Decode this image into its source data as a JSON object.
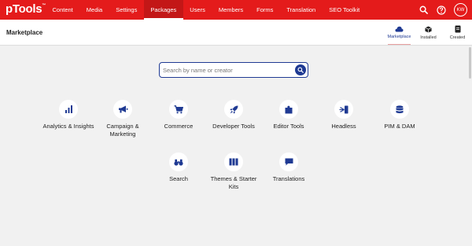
{
  "app": {
    "logo_text": "pTools",
    "logo_mark": "™"
  },
  "nav": {
    "items": [
      {
        "label": "Content",
        "active": false
      },
      {
        "label": "Media",
        "active": false
      },
      {
        "label": "Settings",
        "active": false
      },
      {
        "label": "Packages",
        "active": true
      },
      {
        "label": "Users",
        "active": false
      },
      {
        "label": "Members",
        "active": false
      },
      {
        "label": "Forms",
        "active": false
      },
      {
        "label": "Translation",
        "active": false
      },
      {
        "label": "SEO Toolkit",
        "active": false
      }
    ],
    "user_initials": "KW"
  },
  "header": {
    "title": "Marketplace",
    "tabs": [
      {
        "label": "Marketplace",
        "icon": "cloud-icon",
        "active": true
      },
      {
        "label": "Installed",
        "icon": "box-icon",
        "active": false
      },
      {
        "label": "Created",
        "icon": "file-icon",
        "active": false
      }
    ]
  },
  "search": {
    "placeholder": "Search by name or creator",
    "value": ""
  },
  "categories": [
    {
      "label": "Analytics & Insights",
      "icon": "bar-chart-icon"
    },
    {
      "label": "Campaign & Marketing",
      "icon": "megaphone-icon"
    },
    {
      "label": "Commerce",
      "icon": "cart-icon"
    },
    {
      "label": "Developer Tools",
      "icon": "rocket-icon"
    },
    {
      "label": "Editor Tools",
      "icon": "puzzle-icon"
    },
    {
      "label": "Headless",
      "icon": "headless-icon"
    },
    {
      "label": "PIM & DAM",
      "icon": "database-icon"
    },
    {
      "label": "Search",
      "icon": "binoculars-icon"
    },
    {
      "label": "Themes & Starter Kits",
      "icon": "books-icon"
    },
    {
      "label": "Translations",
      "icon": "chat-icon"
    }
  ],
  "colors": {
    "brand_red": "#e41b1b",
    "accent_blue": "#1f3a93",
    "background": "#f1f1f1"
  }
}
